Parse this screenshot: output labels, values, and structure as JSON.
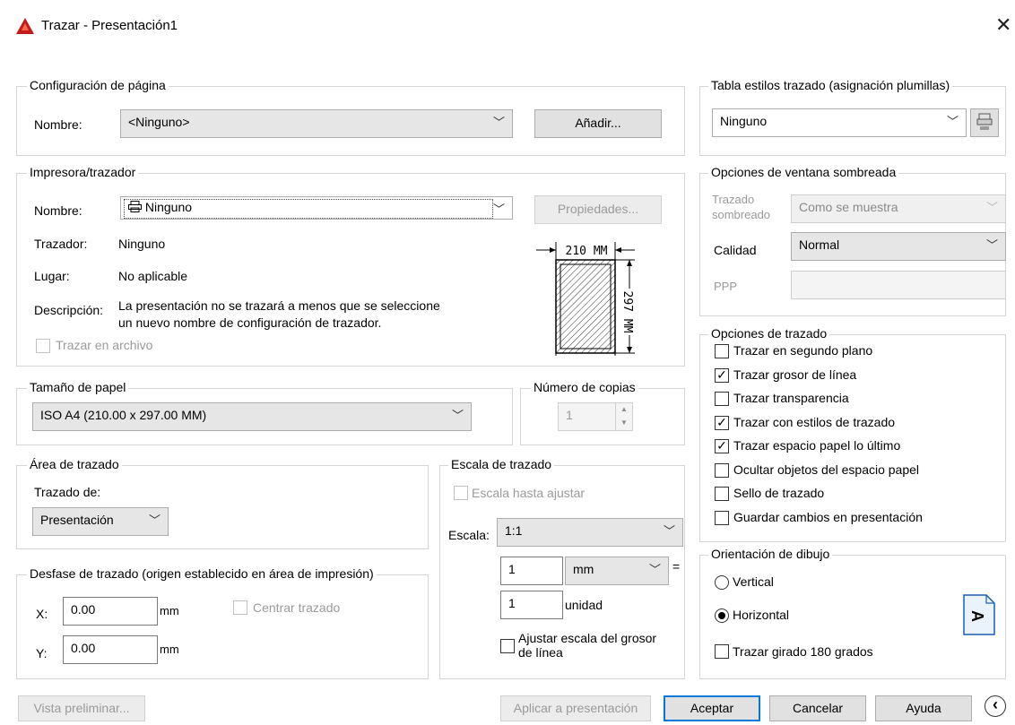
{
  "window": {
    "title": "Trazar - Presentación1",
    "close": "✕"
  },
  "page_setup": {
    "title": "Configuración de página",
    "name_label": "Nombre:",
    "name_value": "<Ninguno>",
    "add_button": "Añadir..."
  },
  "printer": {
    "title": "Impresora/trazador",
    "name_label": "Nombre:",
    "name_value": "Ninguno",
    "properties_button": "Propiedades...",
    "plotter_label": "Trazador:",
    "plotter_value": "Ninguno",
    "where_label": "Lugar:",
    "where_value": "No aplicable",
    "description_label": "Descripción:",
    "description_line1": "La presentación no se trazará a menos que se seleccione",
    "description_line2": "un nuevo nombre de configuración de trazador.",
    "plot_to_file": "Trazar en archivo",
    "preview_width": "210 MM",
    "preview_height": "297 MM"
  },
  "paper_size": {
    "title": "Tamaño de papel",
    "value": "ISO A4 (210.00 x 297.00 MM)"
  },
  "copies": {
    "title": "Número de copias",
    "value": "1"
  },
  "plot_area": {
    "title": "Área de trazado",
    "what_label": "Trazado de:",
    "what_value": "Presentación"
  },
  "plot_offset": {
    "title": "Desfase de trazado (origen establecido en área de impresión)",
    "x_label": "X:",
    "x_value": "0.00",
    "x_unit": "mm",
    "y_label": "Y:",
    "y_value": "0.00",
    "y_unit": "mm",
    "center_plot": "Centrar trazado"
  },
  "plot_scale": {
    "title": "Escala de trazado",
    "fit_to_paper": "Escala hasta ajustar",
    "scale_label": "Escala:",
    "scale_value": "1:1",
    "value1": "1",
    "unit1": "mm",
    "equals": "=",
    "value2": "1",
    "unit2": "unidad",
    "scale_lineweights_1": "Ajustar escala del grosor",
    "scale_lineweights_2": "de línea"
  },
  "plot_style_table": {
    "title": "Tabla estilos trazado (asignación plumillas)",
    "value": "Ninguno"
  },
  "shaded_viewport": {
    "title": "Opciones de ventana sombreada",
    "shade_label_1": "Trazado",
    "shade_label_2": "sombreado",
    "shade_value": "Como se muestra",
    "quality_label": "Calidad",
    "quality_value": "Normal",
    "dpi_label": "PPP"
  },
  "plot_options": {
    "title": "Opciones de trazado",
    "items": [
      {
        "label": "Trazar en segundo plano",
        "mark": ""
      },
      {
        "label": "Trazar grosor de línea",
        "mark": "✓"
      },
      {
        "label": "Trazar transparencia",
        "mark": ""
      },
      {
        "label": "Trazar con estilos de trazado",
        "mark": "✓"
      },
      {
        "label": "Trazar espacio papel lo último",
        "mark": "✓"
      },
      {
        "label": "Ocultar objetos del espacio papel",
        "mark": ""
      },
      {
        "label": "Sello de trazado",
        "mark": ""
      },
      {
        "label": "Guardar cambios en presentación",
        "mark": ""
      }
    ]
  },
  "orientation": {
    "title": "Orientación de dibujo",
    "portrait": "Vertical",
    "landscape": "Horizontal",
    "upside_down": "Trazar girado 180 grados",
    "icon_letter": "A"
  },
  "footer": {
    "preview": "Vista preliminar...",
    "apply": "Aplicar a presentación",
    "ok": "Aceptar",
    "cancel": "Cancelar",
    "help": "Ayuda",
    "collapse": "‹"
  },
  "colors": {
    "accent": "#0078d7",
    "autocad_red": "#c41a1a"
  }
}
